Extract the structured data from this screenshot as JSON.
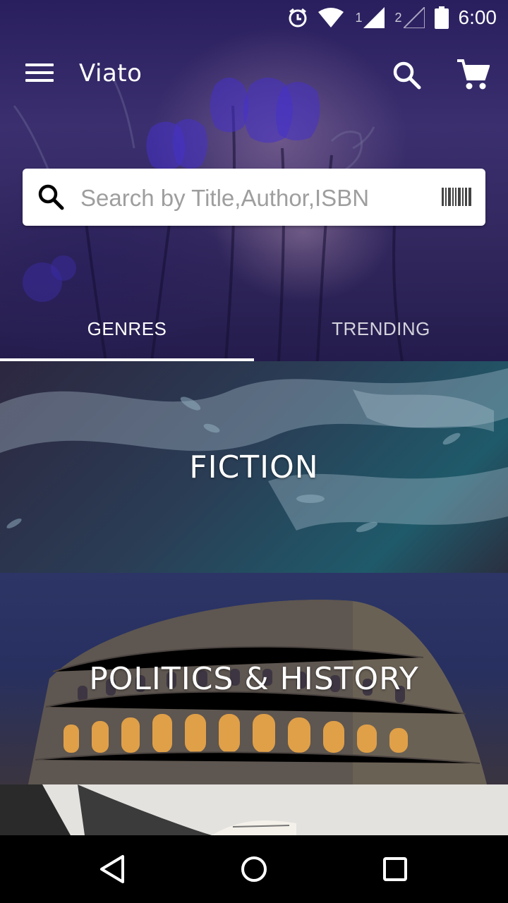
{
  "status_bar": {
    "time": "6:00",
    "sim1": "1",
    "sim2": "2",
    "icons": [
      "alarm-icon",
      "wifi-icon",
      "signal-icon",
      "signal-icon",
      "battery-icon"
    ]
  },
  "toolbar": {
    "title": "Viato",
    "icons": [
      "menu-icon",
      "search-icon",
      "cart-icon"
    ]
  },
  "search": {
    "placeholder": "Search by Title,Author,ISBN",
    "value": "",
    "icons": [
      "search-icon",
      "barcode-icon"
    ]
  },
  "tabs": [
    {
      "label": "GENRES",
      "selected": true
    },
    {
      "label": "TRENDING",
      "selected": false
    }
  ],
  "genres": [
    {
      "label": "FICTION"
    },
    {
      "label": "POLITICS & HISTORY"
    },
    {
      "label": ""
    }
  ],
  "nav": {
    "icons": [
      "back-icon",
      "home-icon",
      "recents-icon"
    ]
  },
  "colors": {
    "accent": "#ffffff",
    "search_bg": "#ffffff",
    "hero_base": "#2f2563"
  }
}
